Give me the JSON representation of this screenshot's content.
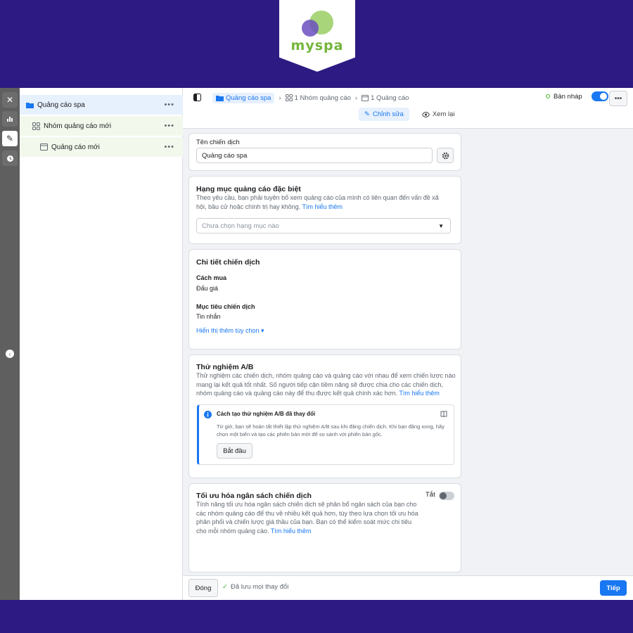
{
  "brand": {
    "name": "myspa",
    "colors": {
      "primary_bg": "#2d1a82",
      "logo_green": "#74b53a",
      "logo_purple": "#6b4fbf",
      "accent": "#1877f2"
    }
  },
  "rail": {
    "icons": [
      "close-icon",
      "chart-icon",
      "pencil-icon",
      "clock-icon"
    ],
    "collapse_icon": "chevron-left-icon"
  },
  "tree": {
    "items": [
      {
        "label": "Quảng cáo spa",
        "icon": "folder-icon",
        "more": "•••"
      },
      {
        "label": "Nhóm quảng cáo mới",
        "icon": "grid-icon",
        "more": "•••"
      },
      {
        "label": "Quảng cáo mới",
        "icon": "ad-icon",
        "more": "•••"
      }
    ]
  },
  "topbar": {
    "breadcrumbs": [
      "Quảng cáo spa",
      "1 Nhóm quảng cáo",
      "1 Quảng cáo"
    ],
    "draft_label": "Bản nháp",
    "more_label": "•••",
    "tabs": [
      "Chỉnh sửa",
      "Xem lại"
    ]
  },
  "campaign_name": {
    "label": "Tên chiến dịch",
    "value": "Quảng cáo spa"
  },
  "special_category": {
    "title": "Hạng mục quảng cáo đặc biệt",
    "description": "Theo yêu cầu, bạn phải tuyên bố xem quảng cáo của mình có liên quan đến vấn đề xã hội, bầu cử hoặc chính trị hay không.",
    "link": "Tìm hiểu thêm",
    "select_placeholder": "Chưa chọn hạng mục nào"
  },
  "details": {
    "title": "Chi tiết chiến dịch",
    "buy_label": "Cách mua",
    "buy_value": "Đấu giá",
    "objective_label": "Mục tiêu chiến dịch",
    "objective_value": "Tin nhắn",
    "more_options": "Hiển thị thêm tùy chọn ▾"
  },
  "ab_test": {
    "title": "Thử nghiệm A/B",
    "description": "Thử nghiệm các chiến dịch, nhóm quảng cáo và quảng cáo với nhau để xem chiến lược nào mang lại kết quả tốt nhất. Số người tiếp cận tiềm năng sẽ được chia cho các chiến dịch, nhóm quảng cáo và quảng cáo này để thu được kết quả chính xác hơn.",
    "link": "Tìm hiểu thêm",
    "notice_title": "Cách tạo thử nghiệm A/B đã thay đổi",
    "notice_text": "Từ giờ, bạn sẽ hoàn tất thiết lập thử nghiệm A/B sau khi đăng chiến dịch. Khi bạn đăng xong, hãy chọn một biến và tạo các phiên bản mới để so sánh với phiên bản gốc.",
    "start_button": "Bắt đầu"
  },
  "budget": {
    "title": "Tối ưu hóa ngân sách chiến dịch",
    "toggle_label": "Tắt",
    "description": "Tính năng tối ưu hóa ngân sách chiến dịch sẽ phân bổ ngân sách của bạn cho các nhóm quảng cáo để thu về nhiều kết quả hơn, tùy theo lựa chọn tối ưu hóa phân phối và chiến lược giá thầu của bạn. Bạn có thể kiểm soát mức chi tiêu cho mỗi nhóm quảng cáo.",
    "link": "Tìm hiểu thêm"
  },
  "footer": {
    "close_button": "Đóng",
    "saved_text": "Đã lưu mọi thay đổi",
    "next_button": "Tiếp"
  }
}
